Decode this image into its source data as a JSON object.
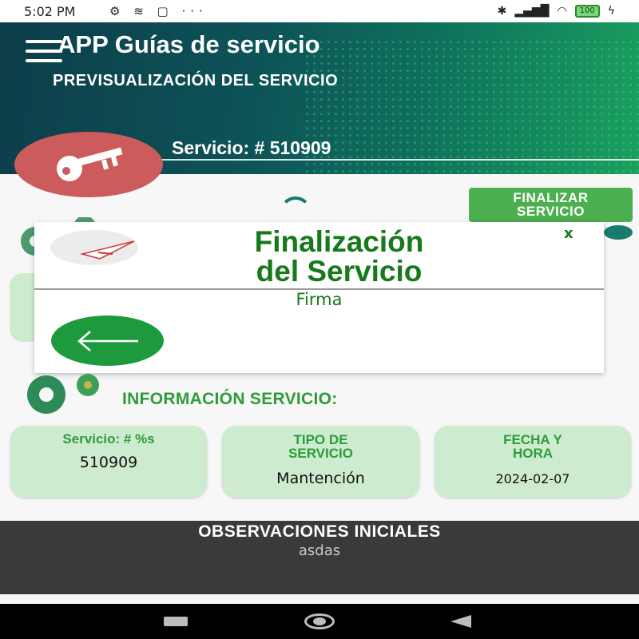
{
  "status_bar": {
    "time": "5:02 PM",
    "left_icons": "⚙ ≋ ▢ ···",
    "battery": "100",
    "icons": [
      "settings-icon",
      "signal-icon",
      "wifi-icon",
      "battery-icon"
    ]
  },
  "header": {
    "app_title": "APP Guías de servicio",
    "subtitle": "PREVISUALIZACIÓN DEL SERVICIO",
    "service_label": "Servicio: # 510909"
  },
  "finalizar_button": {
    "label_line1": "FINALIZAR",
    "label_line2": "SERVICIO"
  },
  "modal": {
    "title_line1": "Finalización",
    "title_line2": "del Servicio",
    "close_label": "x",
    "subtitle": "Firma"
  },
  "info": {
    "heading": "INFORMACIÓN SERVICIO:",
    "cards": [
      {
        "label": "Servicio: # %s",
        "value": "510909"
      },
      {
        "label_line1": "TIPO DE",
        "label_line2": "SERVICIO",
        "value": "Mantención"
      },
      {
        "label_line1": "FECHA Y",
        "label_line2": "HORA",
        "value": "2024-02-07"
      }
    ]
  },
  "observaciones": {
    "title": "OBSERVACIONES INICIALES",
    "value": "asdas"
  },
  "colors": {
    "accent_green": "#16791a",
    "card_bg": "#cdeccf",
    "key_badge": "#cc5b5b",
    "header_dark": "#0d3d4a",
    "button_green": "#4caf50"
  }
}
